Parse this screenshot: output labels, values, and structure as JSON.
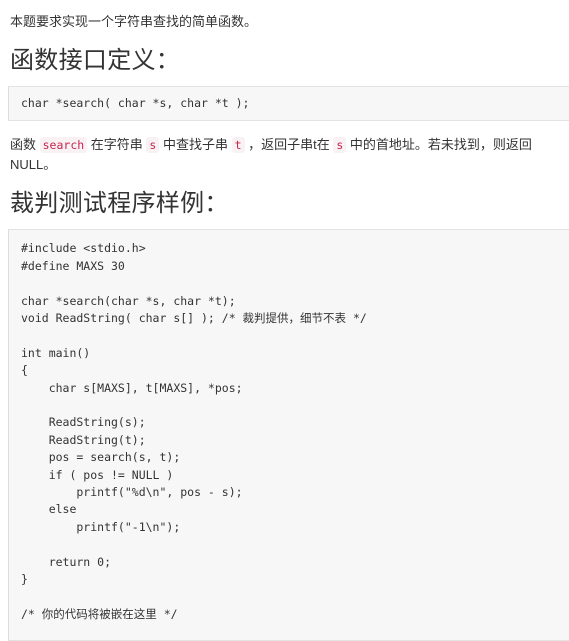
{
  "page": {
    "background": "#ffffff",
    "text_color": "#333333"
  },
  "intro": {
    "text": "本题要求实现一个字符串查找的简单函数。"
  },
  "sections": [
    {
      "heading": "函数接口定义：",
      "code": "char *search( char *s, char *t );"
    },
    {
      "heading": "裁判测试程序样例："
    }
  ],
  "description": {
    "prefix": "函数 ",
    "code1": "search",
    "mid1": " 在字符串 ",
    "code2": "s",
    "mid2": " 中查找子串 ",
    "code3": "t",
    "mid3": " ，返回子串t在 ",
    "code4": "s",
    "suffix": " 中的首地址。若未找到，则返回NULL。"
  },
  "judge_code": {
    "lines": [
      "#include <stdio.h>",
      "#define MAXS 30",
      "",
      "char *search(char *s, char *t);",
      "void ReadString( char s[] ); /* 裁判提供，细节不表 */",
      "",
      "int main()",
      "{",
      "    char s[MAXS], t[MAXS], *pos;",
      "",
      "    ReadString(s);",
      "    ReadString(t);",
      "    pos = search(s, t);",
      "    if ( pos != NULL )",
      "        printf(\"%d\\n\", pos - s);",
      "    else",
      "        printf(\"-1\\n\");",
      "",
      "    return 0;",
      "}",
      "",
      "/* 你的代码将被嵌在这里 */"
    ]
  },
  "colors": {
    "inline_code_text": "#c7254e",
    "inline_code_bg": "#f9f2f4",
    "code_block_bg": "#f7f7f7",
    "code_block_border": "#e3e3e3"
  }
}
